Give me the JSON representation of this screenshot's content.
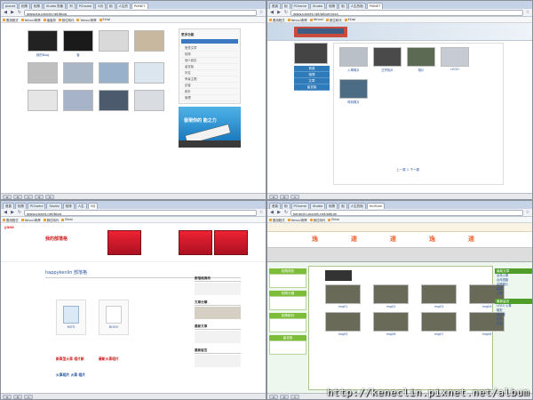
{
  "q1": {
    "tabs": [
      "pixnet",
      "相簿",
      "相簿",
      "Studio 對象",
      "列",
      "PChome",
      "5月",
      "相",
      "人生的",
      "PIXNET"
    ],
    "url": "www.bp.pixnet.net/blog",
    "bookmarks": [
      "應用程式",
      "Yahoo!奇摩",
      "痞客邦",
      "數位時代",
      "Yahoo!奇摩",
      "Ekiwi"
    ],
    "thumbs": [
      {
        "caption": "我的Blog",
        "color": "#222"
      },
      {
        "caption": "客",
        "color": "#1a1a1a"
      },
      {
        "caption": "",
        "color": "#d9d9d9"
      },
      {
        "caption": "",
        "color": "#c8b8a0"
      },
      {
        "caption": "",
        "color": "#bfbfbf"
      },
      {
        "caption": "",
        "color": "#a9b7c6"
      },
      {
        "caption": "",
        "color": "#9ab1cc"
      },
      {
        "caption": "",
        "color": "#dbe6ef"
      },
      {
        "caption": "",
        "color": "#e5e5e5"
      },
      {
        "caption": "",
        "color": "#a7b3c9"
      },
      {
        "caption": "",
        "color": "#4b5a6d"
      },
      {
        "caption": "",
        "color": "#d9dde2"
      }
    ],
    "panel": {
      "title": "更多功能",
      "items": [
        "發表文章",
        "相簿",
        "個人設定",
        "留言板",
        "好友",
        "佈景主題",
        "訪客",
        "統計",
        "管理"
      ]
    },
    "ad_text": "發現你的 能之力",
    "status": [
      "a",
      "b",
      "c",
      "d",
      "e"
    ]
  },
  "q2": {
    "tabs": [
      "首頁",
      "相",
      "PChome",
      "Studio",
      "相簿",
      "相",
      "人生的相",
      "PIXNET"
    ],
    "url": "www.pixnet.net/album/xxx",
    "bookmarks": [
      "應用程式",
      "Yahoo!奇摩",
      "Yahoo!",
      "數位時代",
      "Ekiwi"
    ],
    "menu": [
      "首頁",
      "相簿",
      "文章",
      "留言板"
    ],
    "items": [
      {
        "caption": "火車照片",
        "color": "#b9c0c7"
      },
      {
        "caption": "正宗相片",
        "color": "#4a4a4a"
      },
      {
        "caption": "相片",
        "color": "#5c6a53"
      },
      {
        "caption": "LEGO",
        "color": "#c7ccd4"
      }
    ],
    "items2": [
      {
        "caption": "時刻照片",
        "color": "#4c6c86"
      }
    ],
    "pager": "上一頁 1 下一頁",
    "status": [
      "a",
      "b",
      "c"
    ]
  },
  "q3": {
    "tabs": [
      "首頁",
      "相簿",
      "PChome",
      "Studio",
      "相簿",
      "人生",
      "5月"
    ],
    "url": "www.pixnet.net/blog",
    "bookmarks": [
      "應用程式",
      "Yahoo!奇摩",
      "數位時代",
      "Ekiwi"
    ],
    "logo": "yaoo",
    "title": "我的部落格",
    "sitename": "happykenlin 部落格",
    "card1": "MOTI",
    "card2": "BOOO",
    "news1": "新車型火車 相片新",
    "news2": "最新火車相片",
    "news3": "火車相片 火車 相片",
    "sidebar": [
      "部落格資訊",
      "文章分類",
      "最新文章",
      "最新留言"
    ],
    "status": [
      "a",
      "b",
      "c"
    ]
  },
  "q4": {
    "tabs": [
      "首頁",
      "相",
      "PChome",
      "Studio",
      "相簿",
      "相",
      "人生的相",
      "YouTube"
    ],
    "url": "keneclin.pixnet.net/album",
    "bookmarks": [
      "應用程式",
      "Yahoo!奇摩",
      "數位時代",
      "Ekiwi"
    ],
    "marquee": [
      "逸",
      "達",
      "達",
      "逸",
      "達"
    ],
    "left_sections": [
      "相簿資訊",
      "相簿分類",
      "相簿統計",
      "留言板"
    ],
    "right_sections": [
      "最新文章",
      "最新留言"
    ],
    "right_links": [
      "台灣火車",
      "台灣鐵路",
      "高鐵照片",
      "捷運",
      "火車",
      "LEGO 火車",
      "模型",
      "相片集",
      "好友",
      "訪客"
    ],
    "caption_items": [
      "img01",
      "img02",
      "img03",
      "img04",
      "img05",
      "img06",
      "img07",
      "img08"
    ],
    "status": [
      "a",
      "b",
      "c"
    ]
  },
  "watermark": "http://keneclin.pixnet.net/album"
}
